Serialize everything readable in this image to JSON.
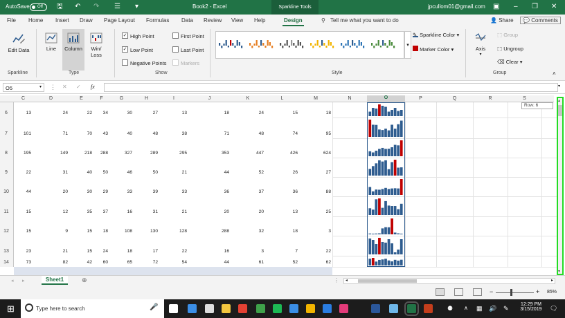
{
  "titlebar": {
    "autosave_label": "AutoSave",
    "autosave_state": "Off",
    "doc_title": "Book2 - Excel",
    "context_tab": "Sparkline Tools",
    "user_email": "jpcullom01@gmail.com"
  },
  "tabs": [
    "File",
    "Home",
    "Insert",
    "Draw",
    "Page Layout",
    "Formulas",
    "Data",
    "Review",
    "View",
    "Help",
    "Design"
  ],
  "tell_me": "Tell me what you want to do",
  "share_label": "Share",
  "comments_label": "Comments",
  "ribbon": {
    "sparkline_group": {
      "edit_data": "Edit Data",
      "label": "Sparkline"
    },
    "type_group": {
      "line": "Line",
      "column": "Column",
      "winloss": "Win/ Loss",
      "label": "Type"
    },
    "show_group": {
      "high_point": "High Point",
      "low_point": "Low Point",
      "negative_points": "Negative Points",
      "first_point": "First Point",
      "last_point": "Last Point",
      "markers": "Markers",
      "label": "Show"
    },
    "style_group": {
      "label": "Style",
      "sparkline_color": "Sparkline Color",
      "marker_color": "Marker Color"
    },
    "group_group": {
      "axis": "Axis",
      "group": "Group",
      "ungroup": "Ungroup",
      "clear": "Clear",
      "label": "Group"
    }
  },
  "name_box": "O5",
  "fx_label": "fx",
  "columns": [
    "C",
    "D",
    "E",
    "F",
    "G",
    "H",
    "I",
    "J",
    "K",
    "L",
    "M",
    "N",
    "O",
    "P",
    "Q",
    "R",
    "S"
  ],
  "rows": [
    {
      "num": "6",
      "values": [
        "13",
        "24",
        "22",
        "34",
        "30",
        "27",
        "13",
        "18",
        "24",
        "15",
        "18"
      ]
    },
    {
      "num": "7",
      "values": [
        "101",
        "71",
        "70",
        "43",
        "40",
        "48",
        "38",
        "71",
        "48",
        "74",
        "95"
      ]
    },
    {
      "num": "8",
      "values": [
        "195",
        "149",
        "218",
        "288",
        "327",
        "289",
        "295",
        "353",
        "447",
        "426",
        "624"
      ]
    },
    {
      "num": "9",
      "values": [
        "22",
        "31",
        "40",
        "50",
        "46",
        "50",
        "21",
        "44",
        "52",
        "26",
        "27"
      ]
    },
    {
      "num": "10",
      "values": [
        "44",
        "20",
        "30",
        "29",
        "33",
        "39",
        "33",
        "36",
        "37",
        "36",
        "88"
      ]
    },
    {
      "num": "11",
      "values": [
        "15",
        "12",
        "35",
        "37",
        "16",
        "31",
        "21",
        "20",
        "20",
        "13",
        "25"
      ]
    },
    {
      "num": "12",
      "values": [
        "15",
        "9",
        "15",
        "18",
        "108",
        "130",
        "128",
        "288",
        "32",
        "18",
        "3"
      ]
    },
    {
      "num": "13",
      "values": [
        "23",
        "21",
        "15",
        "24",
        "18",
        "17",
        "22",
        "16",
        "3",
        "7",
        "22"
      ]
    },
    {
      "num": "14",
      "values": [
        "73",
        "82",
        "42",
        "60",
        "65",
        "72",
        "54",
        "44",
        "61",
        "52",
        "62"
      ]
    }
  ],
  "row_tooltip": "Row: 6",
  "sheet_tab": "Sheet1",
  "zoom": "85%",
  "taskbar": {
    "search": "Type here to search",
    "time": "12:29 PM",
    "date": "3/15/2019"
  },
  "colors": {
    "excel_green": "#217346",
    "bar_blue": "#2e5c8f",
    "bar_red": "#c00000",
    "highlight_green": "#22dd22"
  }
}
